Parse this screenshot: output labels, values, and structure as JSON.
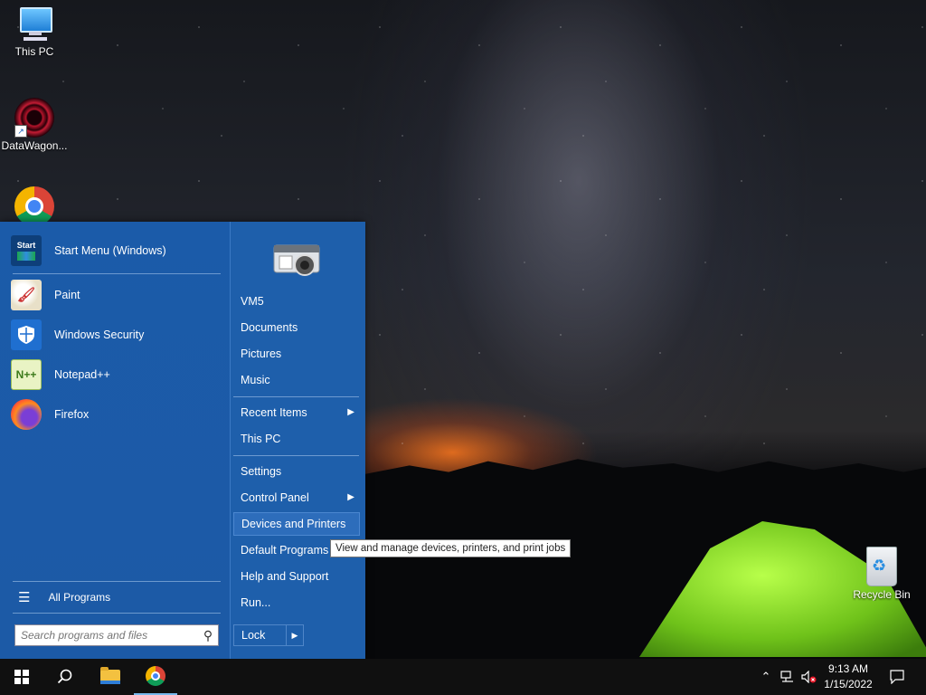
{
  "desktop": {
    "icons": [
      {
        "label": "This PC"
      },
      {
        "label": "DataWagon..."
      },
      {
        "label": ""
      },
      {
        "label": "Recycle Bin"
      }
    ]
  },
  "start_menu": {
    "pinned": [
      {
        "label": "Start Menu (Windows)",
        "icon": "start-menu-icon"
      },
      {
        "label": "Paint",
        "icon": "paint-icon"
      },
      {
        "label": "Windows Security",
        "icon": "shield-icon"
      },
      {
        "label": "Notepad++",
        "icon": "notepad-icon"
      },
      {
        "label": "Firefox",
        "icon": "firefox-icon"
      }
    ],
    "start_icon_text": "Start",
    "all_programs": "All Programs",
    "search_placeholder": "Search programs and files",
    "right": {
      "user": "VM5",
      "documents": "Documents",
      "pictures": "Pictures",
      "music": "Music",
      "recent_items": "Recent Items",
      "this_pc": "This PC",
      "settings": "Settings",
      "control_panel": "Control Panel",
      "devices_printers": "Devices and Printers",
      "default_programs": "Default Programs",
      "help_support": "Help and Support",
      "run": "Run...",
      "lock": "Lock"
    }
  },
  "tooltip": "View and manage devices, printers, and print jobs",
  "taskbar": {
    "time": "9:13 AM",
    "date": "1/15/2022"
  },
  "colors": {
    "menu_blue": "#1f5ea8",
    "highlight": "#2d6dbb",
    "taskbar": "#101010"
  }
}
